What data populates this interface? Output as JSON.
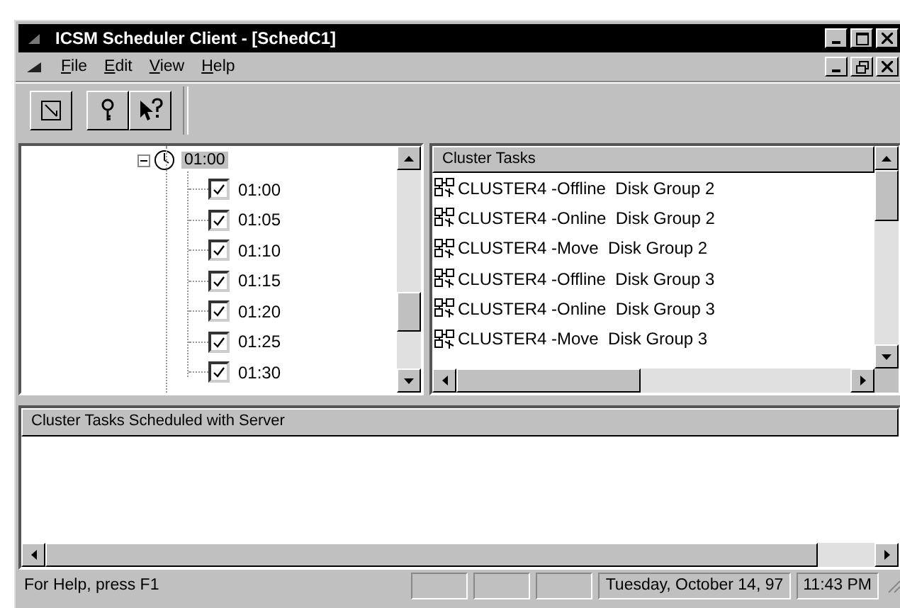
{
  "window": {
    "title": "ICSM Scheduler Client - [SchedC1]"
  },
  "menu": [
    {
      "label": "File"
    },
    {
      "label": "Edit"
    },
    {
      "label": "View"
    },
    {
      "label": "Help"
    }
  ],
  "tree": {
    "label": "01:00",
    "selected": true,
    "expanded": true,
    "children": [
      {
        "label": "01:00",
        "checked": true
      },
      {
        "label": "01:05",
        "checked": true
      },
      {
        "label": "01:10",
        "checked": true
      },
      {
        "label": "01:15",
        "checked": true
      },
      {
        "label": "01:20",
        "checked": true
      },
      {
        "label": "01:25",
        "checked": true
      },
      {
        "label": "01:30",
        "checked": true
      }
    ]
  },
  "tasks": {
    "header": "Cluster Tasks",
    "items": [
      "CLUSTER4 -Offline  Disk Group 2",
      "CLUSTER4 -Online  Disk Group 2",
      "CLUSTER4 -Move  Disk Group 2",
      "CLUSTER4 -Offline  Disk Group 3",
      "CLUSTER4 -Online  Disk Group 3",
      "CLUSTER4 -Move  Disk Group 3"
    ]
  },
  "scheduled": {
    "header": "Cluster Tasks Scheduled with Server"
  },
  "status_bar": {
    "help": "For Help, press F1",
    "date": "Tuesday, October 14, 97",
    "time": "11:43 PM"
  }
}
